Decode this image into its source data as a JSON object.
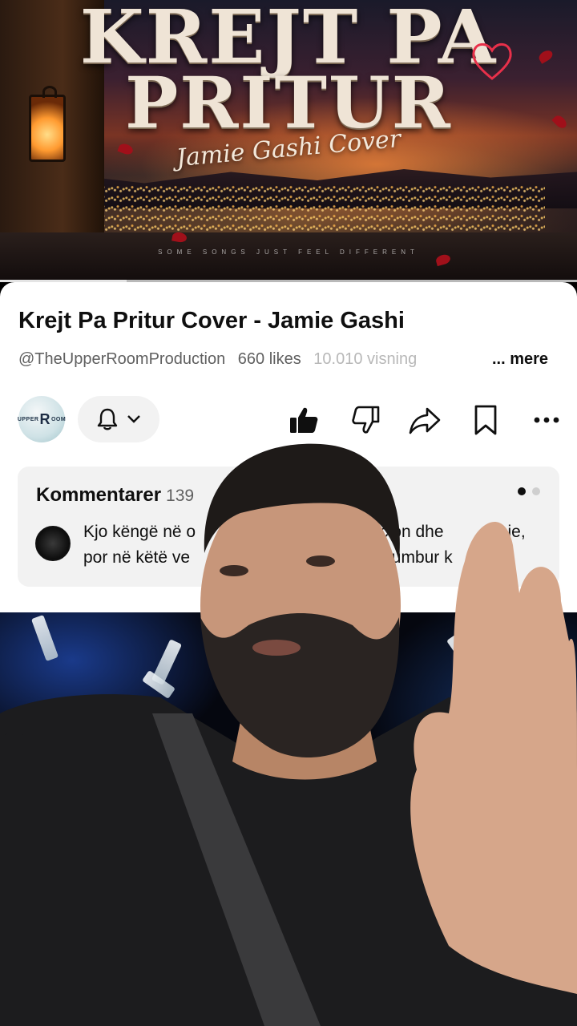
{
  "thumbnail": {
    "title_line1": "KREJT PA",
    "title_line2": "PRITUR",
    "script_text": "Jamie Gashi Cover",
    "tagline": "SOME SONGS JUST FEEL DIFFERENT"
  },
  "player": {
    "progress": 0.22
  },
  "video": {
    "title": "Krejt Pa Pritur Cover - Jamie Gashi",
    "channel": "@TheUpperRoomProduction",
    "likes": "660 likes",
    "views": "10.010 visning",
    "more_label": "... mere"
  },
  "channel_avatar": {
    "pre": "UPPER",
    "mark": "R",
    "post": "OOM"
  },
  "actions": {
    "notify": "bell-icon",
    "like": "thumbs-up-icon",
    "dislike": "thumbs-down-icon",
    "share": "share-icon",
    "save": "bookmark-icon",
    "more": "more-horizontal-icon"
  },
  "comments": {
    "label": "Kommentarer",
    "count": "139",
    "pager_pages": 2,
    "pager_active": 1,
    "top_comment_line1": "Kjo këngë në o",
    "top_comment_line1_end": "cion dhe",
    "top_comment_line1_tail": "ie,",
    "top_comment_line2": "por në këtë ve",
    "top_comment_line2_end": "humbur k"
  },
  "colors": {
    "card_bg": "#ffffff",
    "text_primary": "#0f0f0f",
    "text_secondary": "#606060",
    "chip_bg": "#f2f2f2",
    "accent_sunset": "#d2692a"
  }
}
